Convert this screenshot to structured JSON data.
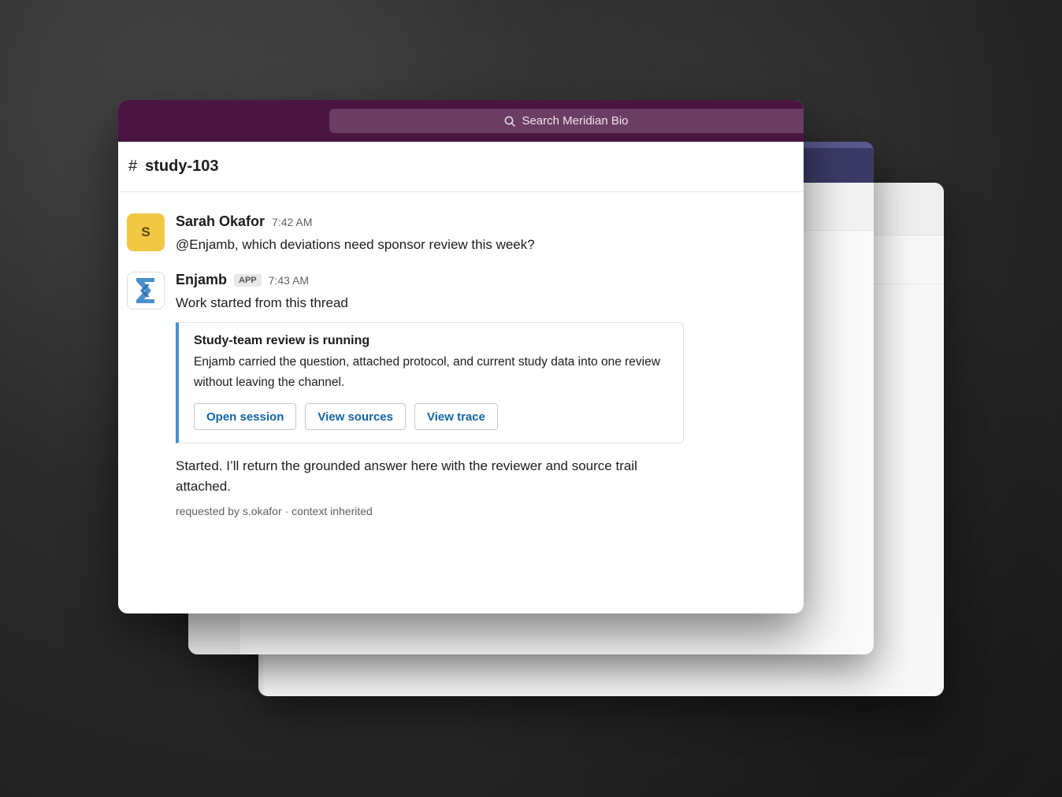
{
  "search": {
    "label": "Search Meridian Bio"
  },
  "channel": {
    "hash": "#",
    "name": "study-103"
  },
  "messages": [
    {
      "avatar_letter": "S",
      "author": "Sarah Okafor",
      "time": "7:42 AM",
      "text": "@Enjamb, which deviations need sponsor review this week?"
    },
    {
      "avatar_icon": "enjamb-logo-icon",
      "author": "Enjamb",
      "badge": "APP",
      "time": "7:43 AM",
      "text": "Work started from this thread",
      "card": {
        "title": "Study-team review is running",
        "description": "Enjamb carried the question, attached protocol, and current study data into one review without leaving the channel.",
        "buttons": [
          "Open session",
          "View sources",
          "View trace"
        ]
      },
      "followup": "Started. I’ll return the grounded answer here with the reviewer and source trail attached.",
      "footnote": "requested by s.okafor · context inherited"
    }
  ],
  "colors": {
    "titlebar": "#4a1543",
    "accent_link": "#1264a3",
    "card_border": "#4a8fcf",
    "avatar_s": "#f2c744"
  }
}
